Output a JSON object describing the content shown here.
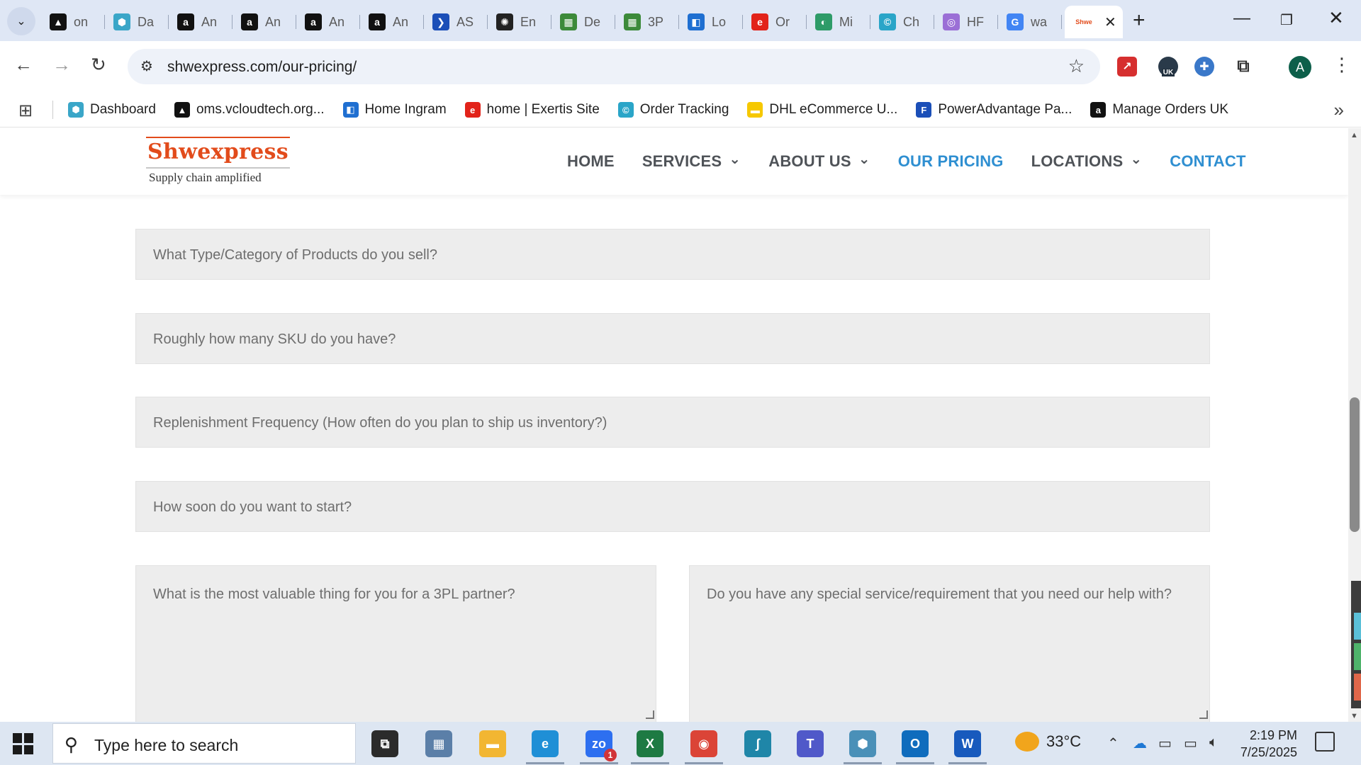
{
  "browser": {
    "tabs": [
      {
        "title": "on",
        "icon": "triangle-logo-icon",
        "color": "#111111",
        "glyph": "▲"
      },
      {
        "title": "Da",
        "icon": "hexagon-icon",
        "color": "#3aa6c8",
        "glyph": "⬢"
      },
      {
        "title": "An",
        "icon": "amazon-icon",
        "color": "#111111",
        "glyph": "a"
      },
      {
        "title": "An",
        "icon": "amazon-icon",
        "color": "#111111",
        "glyph": "a"
      },
      {
        "title": "An",
        "icon": "amazon-icon",
        "color": "#111111",
        "glyph": "a"
      },
      {
        "title": "An",
        "icon": "amazon-icon",
        "color": "#111111",
        "glyph": "a"
      },
      {
        "title": "AS",
        "icon": "chevron-logo-icon",
        "color": "#1b4fb8",
        "glyph": "❯"
      },
      {
        "title": "En",
        "icon": "openai-icon",
        "color": "#222222",
        "glyph": "✺"
      },
      {
        "title": "De",
        "icon": "green-box-icon",
        "color": "#3c8a3a",
        "glyph": "▦"
      },
      {
        "title": "3P",
        "icon": "green-box-icon",
        "color": "#3c8a3a",
        "glyph": "▦"
      },
      {
        "title": "Lo",
        "icon": "blue-flag-icon",
        "color": "#1f6fd1",
        "glyph": "◧"
      },
      {
        "title": "Or",
        "icon": "exertis-icon",
        "color": "#e2231a",
        "glyph": "e"
      },
      {
        "title": "Mi",
        "icon": "green-circle-icon",
        "color": "#2e9b68",
        "glyph": "◐"
      },
      {
        "title": "Ch",
        "icon": "c-logo-icon",
        "color": "#2aa5c8",
        "glyph": "©"
      },
      {
        "title": "HF",
        "icon": "fingerprint-icon",
        "color": "#9b6fd6",
        "glyph": "◎"
      },
      {
        "title": "wa",
        "icon": "google-icon",
        "color": "#4285f4",
        "glyph": "G"
      }
    ],
    "active_tab_icon": "Shwe",
    "url": "shwexpress.com/our-pricing/",
    "bookmarks": [
      {
        "label": "Dashboard",
        "color": "#3aa6c8",
        "glyph": "⬢"
      },
      {
        "label": "oms.vcloudtech.org...",
        "color": "#111111",
        "glyph": "▲"
      },
      {
        "label": "Home Ingram",
        "color": "#1f6fd1",
        "glyph": "◧"
      },
      {
        "label": "home | Exertis Site",
        "color": "#e2231a",
        "glyph": "e"
      },
      {
        "label": "Order Tracking",
        "color": "#2aa5c8",
        "glyph": "©"
      },
      {
        "label": "DHL eCommerce U...",
        "color": "#f6c800",
        "glyph": "▬"
      },
      {
        "label": "PowerAdvantage Pa...",
        "color": "#1b4fb8",
        "glyph": "F"
      },
      {
        "label": "Manage Orders UK",
        "color": "#111111",
        "glyph": "a"
      }
    ],
    "ext_badge": "UK",
    "avatar_letter": "A"
  },
  "site": {
    "logo": {
      "brand": "Shwexpress",
      "tagline": "Supply chain amplified"
    },
    "nav": [
      {
        "label": "HOME",
        "dropdown": false,
        "state": "normal"
      },
      {
        "label": "SERVICES",
        "dropdown": true,
        "state": "normal"
      },
      {
        "label": "ABOUT US",
        "dropdown": true,
        "state": "normal"
      },
      {
        "label": "OUR PRICING",
        "dropdown": false,
        "state": "active"
      },
      {
        "label": "LOCATIONS",
        "dropdown": true,
        "state": "normal"
      },
      {
        "label": "CONTACT",
        "dropdown": false,
        "state": "contact"
      }
    ],
    "accent_color": "#2f8fd1",
    "brand_color": "#e24b1b"
  },
  "form": {
    "product_category": {
      "placeholder": "What Type/Category of Products do you sell?",
      "value": ""
    },
    "sku_count": {
      "placeholder": "Roughly how many SKU do you have?",
      "value": ""
    },
    "replenishment": {
      "placeholder": "Replenishment Frequency (How often do you plan to ship us inventory?)",
      "value": ""
    },
    "start_time": {
      "placeholder": "How soon do you want to start?",
      "value": ""
    },
    "valuable_thing": {
      "placeholder": "What is the most valuable thing for you for a 3PL partner?",
      "value": ""
    },
    "special_requirement": {
      "placeholder": "Do you have any special service/requirement that you need our help with?",
      "value": ""
    }
  },
  "taskbar": {
    "search_placeholder": "Type here to search",
    "apps": [
      {
        "name": "task-view-icon",
        "color": "#2b2b2b",
        "glyph": "⧉"
      },
      {
        "name": "calculator-icon",
        "color": "#5b7fa8",
        "glyph": "▦"
      },
      {
        "name": "file-explorer-icon",
        "color": "#f2b632",
        "glyph": "▬"
      },
      {
        "name": "edge-icon",
        "color": "#1f8fd6",
        "glyph": "e"
      },
      {
        "name": "zoom-icon",
        "color": "#2d6ff0",
        "glyph": "zo"
      },
      {
        "name": "excel-icon",
        "color": "#1e7a43",
        "glyph": "X"
      },
      {
        "name": "chrome-icon",
        "color": "#db4437",
        "glyph": "◉"
      },
      {
        "name": "sublime-icon",
        "color": "#1f86a8",
        "glyph": "ʃ"
      },
      {
        "name": "teams-icon",
        "color": "#5059c9",
        "glyph": "T"
      },
      {
        "name": "app-icon",
        "color": "#4a90b8",
        "glyph": "⬢"
      },
      {
        "name": "outlook-icon",
        "color": "#0f6cbd",
        "glyph": "O"
      },
      {
        "name": "word-icon",
        "color": "#185abd",
        "glyph": "W"
      }
    ],
    "zoom_badge": "1",
    "weather": "33°C",
    "time": "2:19 PM",
    "date": "7/25/2025"
  }
}
